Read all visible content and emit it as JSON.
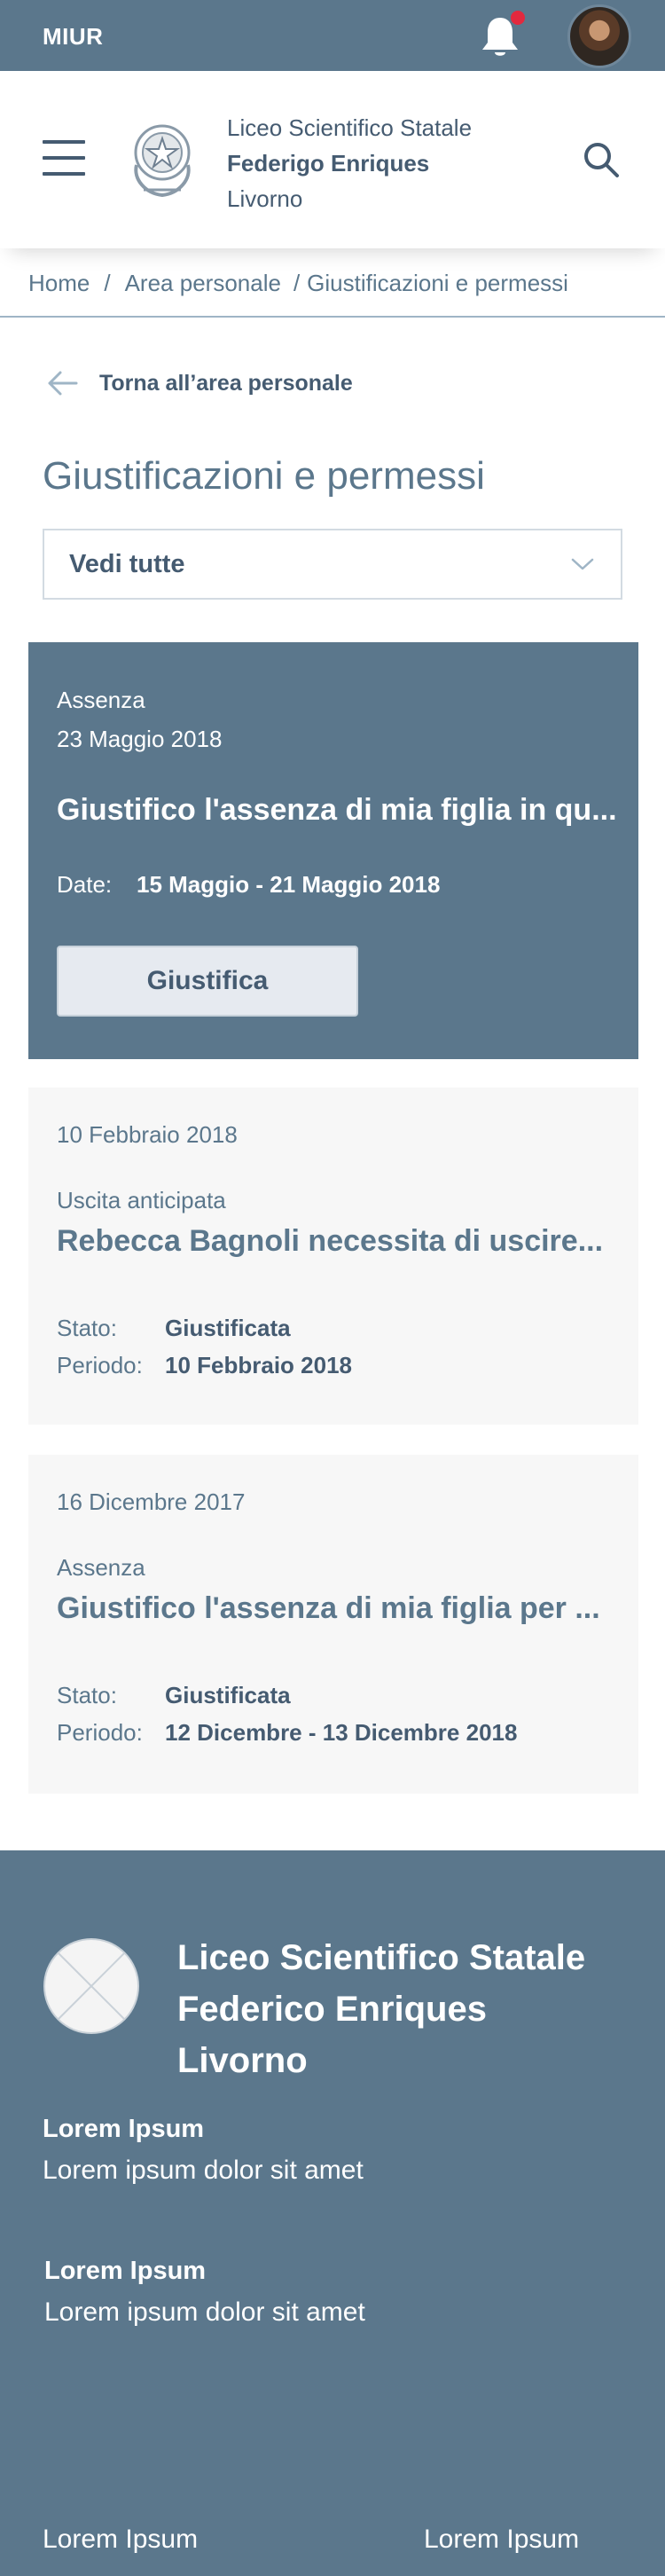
{
  "topbar": {
    "brand": "MIUR",
    "notification_dot_color": "#e2293e"
  },
  "header": {
    "school_line1": "Liceo Scientifico Statale",
    "school_line2": "Federigo Enriques",
    "school_line3": "Livorno"
  },
  "breadcrumb": {
    "items": [
      "Home",
      "Area personale",
      "Giustificazioni e permessi"
    ],
    "separators": [
      "/",
      "/"
    ]
  },
  "back_link": {
    "label": "Torna all’area personale"
  },
  "page_title": "Giustificazioni e permessi",
  "filter": {
    "selected": "Vedi tutte"
  },
  "featured": {
    "category": "Assenza",
    "date": "23 Maggio 2018",
    "title": "Giustifico l'assenza di mia figlia in qu...",
    "date_label": "Date:",
    "date_range": "15 Maggio - 21 Maggio 2018",
    "button": "Giustifica"
  },
  "items": [
    {
      "date": "10 Febbraio 2018",
      "category": "Uscita anticipata",
      "title": "Rebecca Bagnoli necessita di uscire...",
      "stato_label": "Stato:",
      "stato": "Giustificata",
      "periodo_label": "Periodo:",
      "periodo": "10 Febbraio 2018"
    },
    {
      "date": "16 Dicembre 2017",
      "category": "Assenza",
      "title": "Giustifico l'assenza di mia figlia per ...",
      "stato_label": "Stato:",
      "stato": "Giustificata",
      "periodo_label": "Periodo:",
      "periodo": "12 Dicembre - 13 Dicembre 2018"
    }
  ],
  "footer": {
    "title_line1": "Liceo Scientifico Statale",
    "title_line2": "Federico Enriques",
    "title_line3": "Livorno",
    "blocks": [
      {
        "title": "Lorem Ipsum",
        "text": "Lorem ipsum dolor sit amet"
      },
      {
        "title": "Lorem Ipsum",
        "text": "Lorem ipsum dolor sit amet"
      }
    ],
    "bottom_left": "Lorem Ipsum",
    "bottom_right": "Lorem Ipsum"
  },
  "colors": {
    "primary": "#5b778c",
    "text": "#455b71",
    "light_bg": "#f7f7f7",
    "button_bg": "#e6eaf0"
  }
}
